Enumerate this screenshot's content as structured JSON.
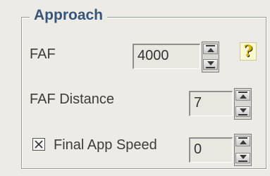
{
  "group": {
    "title": "Approach"
  },
  "faf": {
    "label": "FAF",
    "value": "4000"
  },
  "faf_distance": {
    "label": "FAF Distance",
    "value": "7"
  },
  "final_app_speed": {
    "label": "Final App Speed",
    "value": "0",
    "checked": true
  },
  "help": {
    "glyph": "?"
  },
  "colors": {
    "legend": "#36557a",
    "panel_bg": "#ecebe6",
    "help_bg": "#fafad2"
  }
}
